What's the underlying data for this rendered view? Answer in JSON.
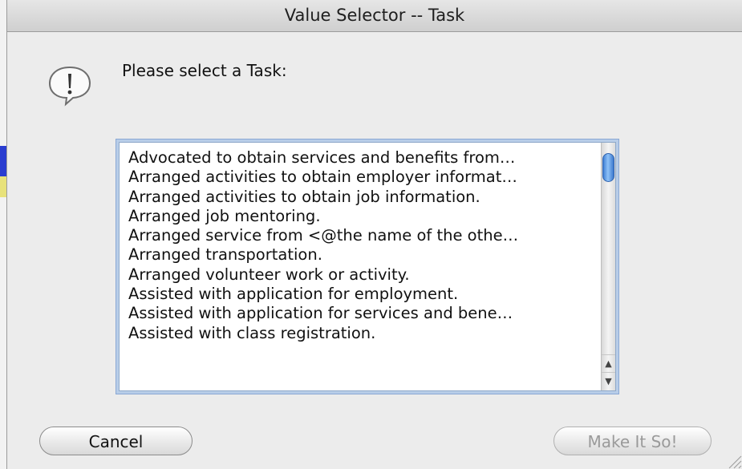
{
  "window": {
    "title": "Value Selector -- Task"
  },
  "dialog": {
    "icon": "alert-icon",
    "prompt": "Please select a Task:",
    "list_items": [
      "Advocated to obtain services and benefits from…",
      "Arranged activities to obtain employer informat…",
      "Arranged activities to obtain job information.",
      "Arranged job mentoring.",
      "Arranged service from <@the name of the othe…",
      "Arranged transportation.",
      "Arranged volunteer work or activity.",
      "Assisted with application for employment.",
      "Assisted with application for services and bene…",
      "Assisted with class registration."
    ],
    "scroll_up_glyph": "▲",
    "scroll_down_glyph": "▼"
  },
  "buttons": {
    "cancel_label": "Cancel",
    "ok_label": "Make It So!"
  },
  "colors": {
    "scroll_thumb": "#4a8ad9",
    "focus_ring": "#8aa8d4",
    "disabled_text": "#9a9a9a"
  }
}
